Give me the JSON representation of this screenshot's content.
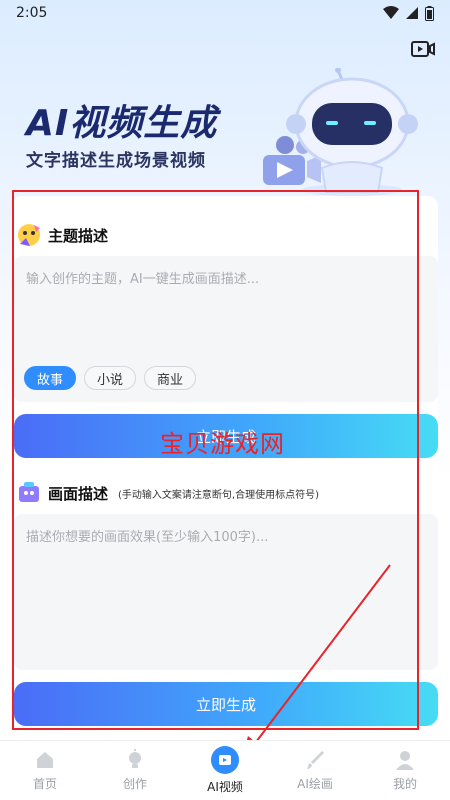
{
  "status_bar": {
    "time": "2:05"
  },
  "banner": {
    "title_ai": "AI",
    "title_rest": "视频生成",
    "subtitle": "文字描述生成场景视频"
  },
  "topic": {
    "title": "主题描述",
    "placeholder": "输入创作的主题，AI一键生成画面描述...",
    "tags": [
      "故事",
      "小说",
      "商业"
    ],
    "active_tag": "故事",
    "button_label": "立即生成"
  },
  "scene": {
    "title": "画面描述",
    "hint": "(手动输入文案请注意断句,合理使用标点符号)",
    "placeholder": "描述你想要的画面效果(至少输入100字)...",
    "button_label": "立即生成"
  },
  "watermark": "宝贝游戏网",
  "tabbar": {
    "items": [
      {
        "label": "首页",
        "icon": "home-icon"
      },
      {
        "label": "创作",
        "icon": "bulb-icon"
      },
      {
        "label": "AI视频",
        "icon": "video-icon"
      },
      {
        "label": "AI绘画",
        "icon": "brush-icon"
      },
      {
        "label": "我的",
        "icon": "user-icon"
      }
    ],
    "active": "AI视频"
  },
  "colors": {
    "accent": "#2f8dff",
    "annotation_red": "#e8242b",
    "title_navy": "#1b2a6e"
  }
}
